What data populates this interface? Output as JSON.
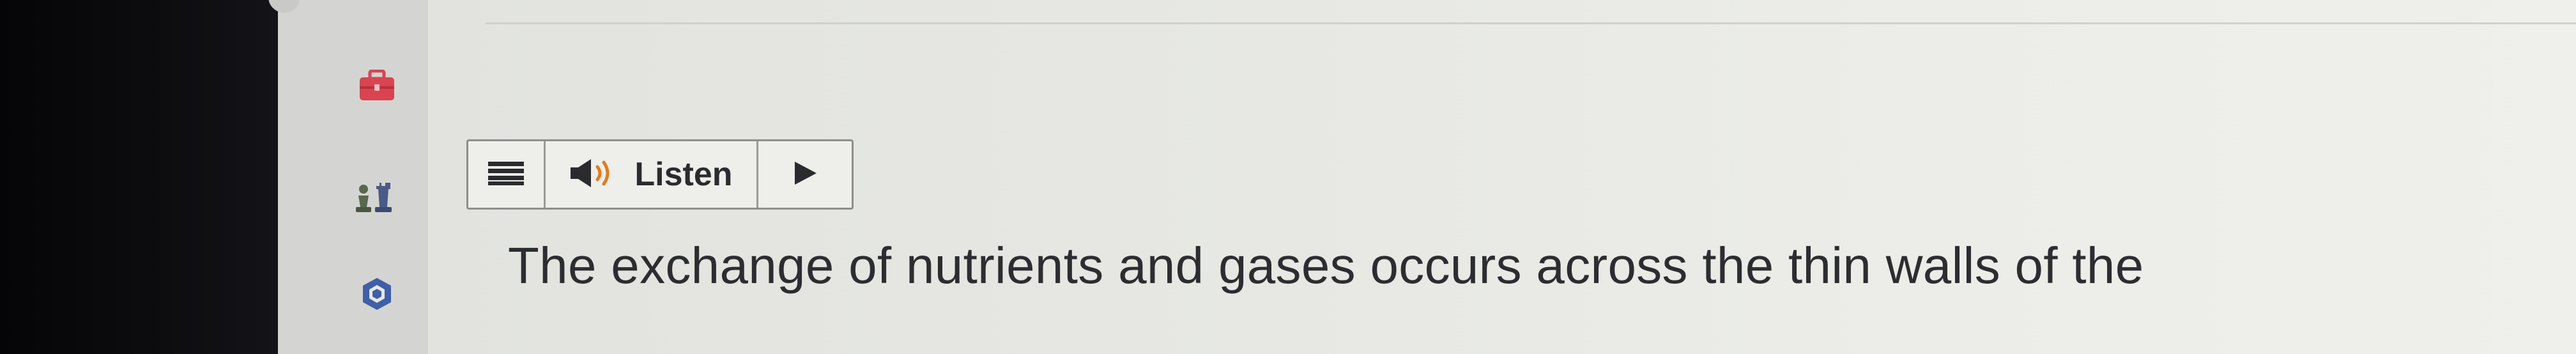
{
  "colors": {
    "background_dark": "#0b0b0c",
    "sidebar": "#d4d5d2",
    "content": "#e7e8e3",
    "briefcase_red": "#d94450",
    "badge_blue": "#3f5fa8",
    "text": "#2c2d30"
  },
  "sidebar": {
    "icons": [
      "briefcase-icon",
      "chess-pieces-icon",
      "badge-icon"
    ]
  },
  "toolbar": {
    "menu_icon": "menu-lines-icon",
    "speaker_icon": "speaker-icon",
    "listen_label": "Listen",
    "play_icon": "play-icon"
  },
  "main": {
    "body_text": "The exchange of nutrients and gases occurs across the thin walls of the"
  }
}
